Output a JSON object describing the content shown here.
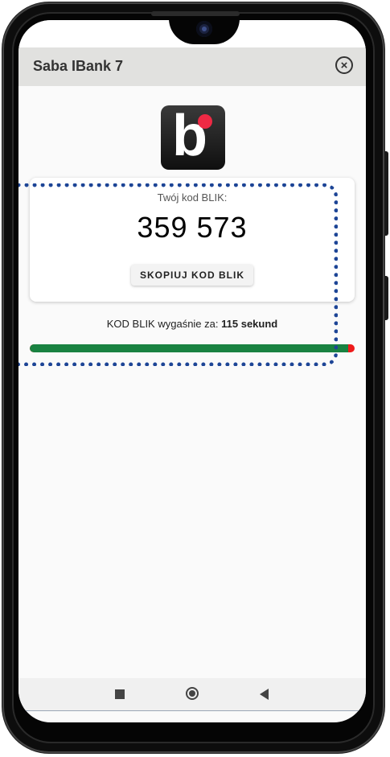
{
  "app": {
    "title": "Saba IBank 7"
  },
  "blik": {
    "code_label": "Twój kod BLIK:",
    "code": "359 573",
    "copy_button": "SKOPIUJ KOD BLIK",
    "expire_prefix": "KOD BLIK wygaśnie za:",
    "expire_value": "115 sekund",
    "progress_fraction": 0.98
  },
  "icons": {
    "close": "close-circle-icon",
    "logo": "blik-logo",
    "nav_recent": "square-icon",
    "nav_home": "circle-icon",
    "nav_back": "triangle-back-icon"
  },
  "colors": {
    "progress": "#198241",
    "progress_remainder": "#ee1a1a",
    "highlight": "#1d4596",
    "appbar": "#e1e1df"
  }
}
